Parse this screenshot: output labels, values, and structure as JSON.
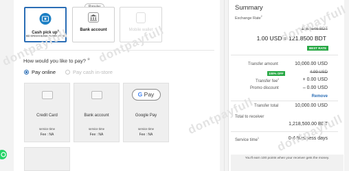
{
  "methods": [
    {
      "label": "Cash pick up",
      "sup": "3",
      "sub": "BD KRISHI BANK IN MINUTES"
    },
    {
      "label": "Bank account",
      "sub": ""
    },
    {
      "label": "Mobile wallet",
      "sub": ""
    }
  ],
  "popular_tag": "Popular",
  "pay_question": "How would you like to pay?",
  "pay_question_sup": "⑧",
  "pay_options": {
    "online": "Pay online",
    "in_store": "Pay cash in-store"
  },
  "pay_cards": [
    {
      "label": "Credit Card",
      "service_time_label": "service time",
      "fee": "Fee : NA"
    },
    {
      "label": "Bank account",
      "service_time_label": "service time",
      "fee": "Fee : NA"
    },
    {
      "label": "Google Pay",
      "service_time_label": "service time",
      "fee": "Fee : NA",
      "badge": "G Pay"
    }
  ],
  "summary": {
    "title": "Summary",
    "exchange_rate_label": "Exchange Rate",
    "exchange_rate_sup": "2",
    "old_rate": "118.8646 BDT",
    "rate": "1.00 USD = 121.8500 BDT",
    "best_rate_badge": "BEST RATE",
    "transfer_amount_label": "Transfer amount",
    "transfer_amount": "10,000.00 USD",
    "off_badge": "100% OFF",
    "old_fee": "4.99 USD",
    "transfer_fee_label": "Transfer fee",
    "transfer_fee_sup": "2",
    "transfer_fee": "+ 0.00 USD",
    "promo_label": "Promo discount",
    "promo": "– 0.00 USD",
    "remove_label": "Remove",
    "transfer_total_label": "Transfer total",
    "transfer_total": "10,000.00 USD",
    "total_receiver_label": "Total to receiver",
    "total_receiver": "1,218,500.00 BDT",
    "service_time_label": "Service time",
    "service_time_sup": "1",
    "service_time": "0-4 Business days",
    "footer": "You'll earn 100 points when your receiver gets the money."
  },
  "watermark": "dontpayfull",
  "colors": {
    "accent": "#2a6db5",
    "success": "#27a844"
  }
}
